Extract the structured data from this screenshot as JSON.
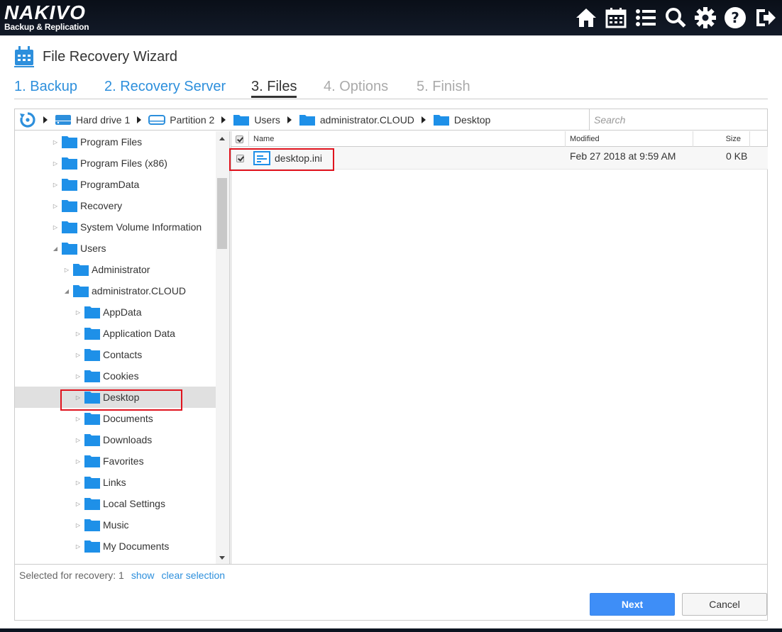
{
  "app": {
    "logo_line1": "NAKIVO",
    "logo_line2": "Backup & Replication"
  },
  "topbar_icons": [
    "home-icon",
    "calendar-icon",
    "list-icon",
    "search-icon",
    "gear-icon",
    "help-icon",
    "logout-icon"
  ],
  "wizard": {
    "title": "File Recovery Wizard",
    "steps": [
      {
        "label": "1. Backup",
        "state": "done"
      },
      {
        "label": "2. Recovery Server",
        "state": "done"
      },
      {
        "label": "3. Files",
        "state": "active"
      },
      {
        "label": "4. Options",
        "state": "future"
      },
      {
        "label": "5. Finish",
        "state": "future"
      }
    ]
  },
  "breadcrumb": {
    "items": [
      "Hard drive 1",
      "Partition 2",
      "Users",
      "administrator.CLOUD",
      "Desktop"
    ],
    "search_placeholder": "Search"
  },
  "tree": {
    "nodes": [
      {
        "label": "Program Files",
        "expanded": false,
        "selected": false
      },
      {
        "label": "Program Files (x86)",
        "expanded": false,
        "selected": false
      },
      {
        "label": "ProgramData",
        "expanded": false,
        "selected": false
      },
      {
        "label": "Recovery",
        "expanded": false,
        "selected": false
      },
      {
        "label": "System Volume Information",
        "expanded": false,
        "selected": false
      },
      {
        "label": "Users",
        "expanded": true,
        "selected": false
      },
      {
        "label": "Administrator",
        "expanded": false,
        "selected": false
      },
      {
        "label": "administrator.CLOUD",
        "expanded": true,
        "selected": false
      },
      {
        "label": "AppData",
        "expanded": false,
        "selected": false
      },
      {
        "label": "Application Data",
        "expanded": false,
        "selected": false
      },
      {
        "label": "Contacts",
        "expanded": false,
        "selected": false
      },
      {
        "label": "Cookies",
        "expanded": false,
        "selected": false
      },
      {
        "label": "Desktop",
        "expanded": false,
        "selected": true
      },
      {
        "label": "Documents",
        "expanded": false,
        "selected": false
      },
      {
        "label": "Downloads",
        "expanded": false,
        "selected": false
      },
      {
        "label": "Favorites",
        "expanded": false,
        "selected": false
      },
      {
        "label": "Links",
        "expanded": false,
        "selected": false
      },
      {
        "label": "Local Settings",
        "expanded": false,
        "selected": false
      },
      {
        "label": "Music",
        "expanded": false,
        "selected": false
      },
      {
        "label": "My Documents",
        "expanded": false,
        "selected": false
      }
    ]
  },
  "filelist": {
    "columns": {
      "name": "Name",
      "modified": "Modified",
      "size": "Size"
    },
    "rows": [
      {
        "name": "desktop.ini",
        "modified": "Feb 27 2018 at 9:59 AM",
        "size": "0 KB",
        "checked": true
      }
    ]
  },
  "status": {
    "selected_text": "Selected for recovery: 1",
    "show_link": "show",
    "clear_link": "clear selection"
  },
  "buttons": {
    "next": "Next",
    "cancel": "Cancel"
  },
  "colors": {
    "accent": "#2d8fdc",
    "folder": "#1e90e8",
    "primary_button": "#3e8ef7",
    "highlight": "#e0141e"
  }
}
